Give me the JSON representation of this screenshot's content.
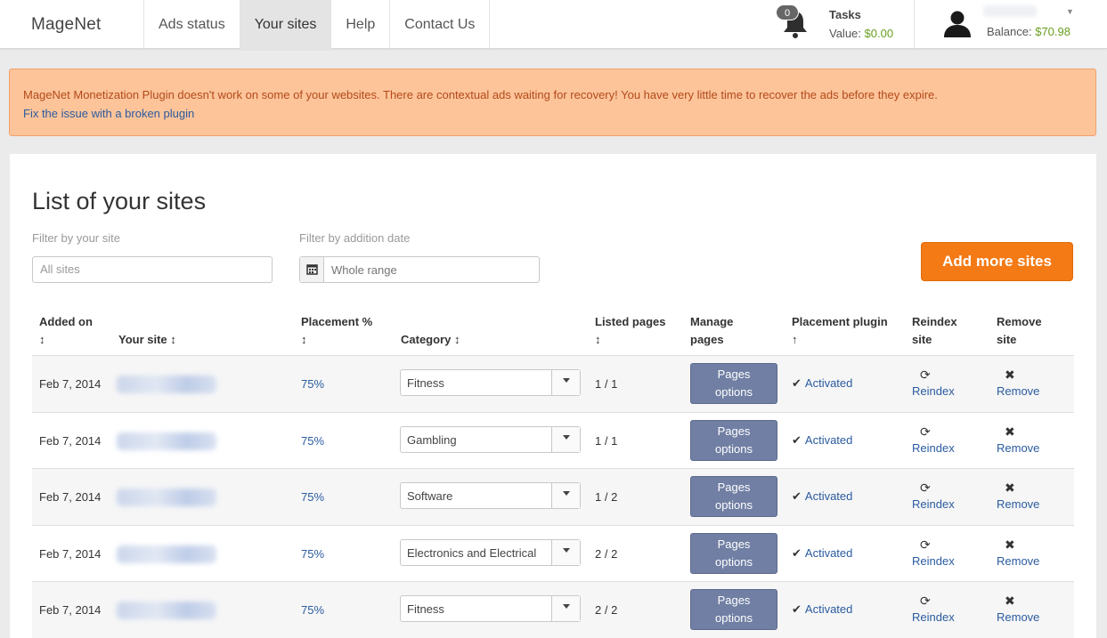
{
  "nav": {
    "brand": "MageNet",
    "tabs": [
      {
        "label": "Ads status"
      },
      {
        "label": "Your sites"
      },
      {
        "label": "Help"
      },
      {
        "label": "Contact Us"
      }
    ],
    "active_tab": "Your sites",
    "tasks": {
      "badge": "0",
      "title": "Tasks",
      "value_label": "Value:",
      "value": "$0.00"
    },
    "user": {
      "balance_label": "Balance:",
      "balance": "$70.98"
    }
  },
  "alert": {
    "message": "MageNet Monetization Plugin doesn't work on some of your websites. There are contextual ads waiting for recovery! You have very little time to recover the ads before they expire.",
    "link": "Fix the issue with a broken plugin"
  },
  "page": {
    "title": "List of your sites",
    "filter_site_label": "Filter by your site",
    "filter_site_placeholder": "All sites",
    "filter_date_label": "Filter by addition date",
    "filter_date_placeholder": "Whole range",
    "add_button": "Add more sites"
  },
  "table": {
    "headers": {
      "added_on": "Added on",
      "your_site": "Your site",
      "placement": "Placement %",
      "category": "Category",
      "listed_pages": "Listed pages",
      "manage_pages_1": "Manage",
      "manage_pages_2": "pages",
      "placement_plugin": "Placement plugin",
      "reindex_1": "Reindex",
      "reindex_2": "site",
      "remove_1": "Remove",
      "remove_2": "site"
    },
    "rows": [
      {
        "date": "Feb 7, 2014",
        "placement": "75%",
        "category": "Fitness",
        "listed": "1 / 1",
        "pages_btn_1": "Pages",
        "pages_btn_2": "options",
        "plugin": "Activated",
        "reindex": "Reindex",
        "remove": "Remove"
      },
      {
        "date": "Feb 7, 2014",
        "placement": "75%",
        "category": "Gambling",
        "listed": "1 / 1",
        "pages_btn_1": "Pages",
        "pages_btn_2": "options",
        "plugin": "Activated",
        "reindex": "Reindex",
        "remove": "Remove"
      },
      {
        "date": "Feb 7, 2014",
        "placement": "75%",
        "category": "Software",
        "listed": "1 / 2",
        "pages_btn_1": "Pages",
        "pages_btn_2": "options",
        "plugin": "Activated",
        "reindex": "Reindex",
        "remove": "Remove"
      },
      {
        "date": "Feb 7, 2014",
        "placement": "75%",
        "category": "Electronics and Electrical",
        "listed": "2 / 2",
        "pages_btn_1": "Pages",
        "pages_btn_2": "options",
        "plugin": "Activated",
        "reindex": "Reindex",
        "remove": "Remove"
      },
      {
        "date": "Feb 7, 2014",
        "placement": "75%",
        "category": "Fitness",
        "listed": "2 / 2",
        "pages_btn_1": "Pages",
        "pages_btn_2": "options",
        "plugin": "Activated",
        "reindex": "Reindex",
        "remove": "Remove"
      }
    ]
  },
  "colors": {
    "accent_orange": "#f47a16",
    "link_blue": "#2a5b9f",
    "money_green": "#6a9f1f",
    "alert_bg": "#fdc49a",
    "button_slate": "#707fa3"
  },
  "icons": {
    "bell": "bell-icon",
    "user": "user-icon",
    "calendar": "calendar-icon",
    "sort": "sort-icon",
    "check": "check-icon",
    "refresh": "refresh-icon",
    "remove": "remove-icon"
  }
}
